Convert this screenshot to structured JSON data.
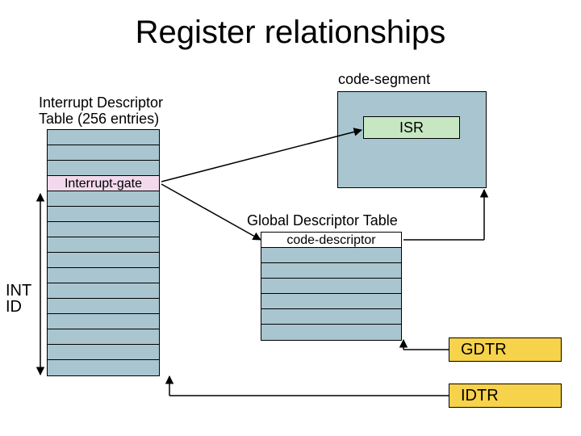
{
  "title": "Register relationships",
  "labels": {
    "code_segment": "code-segment",
    "idt_heading_l1": "Interrupt Descriptor",
    "idt_heading_l2": "Table (256 entries)",
    "gdt_heading": "Global Descriptor Table",
    "interrupt_gate": "Interrupt-gate",
    "code_descriptor": "code-descriptor",
    "isr": "ISR",
    "int_l1": "INT",
    "int_l2": "ID"
  },
  "registers": {
    "gdtr": "GDTR",
    "idtr": "IDTR"
  },
  "colors": {
    "table_fill": "#a9c6d0",
    "gate_fill": "#f3d9ed",
    "isr_fill": "#c7e7c3",
    "reg_fill": "#f7d24b"
  }
}
